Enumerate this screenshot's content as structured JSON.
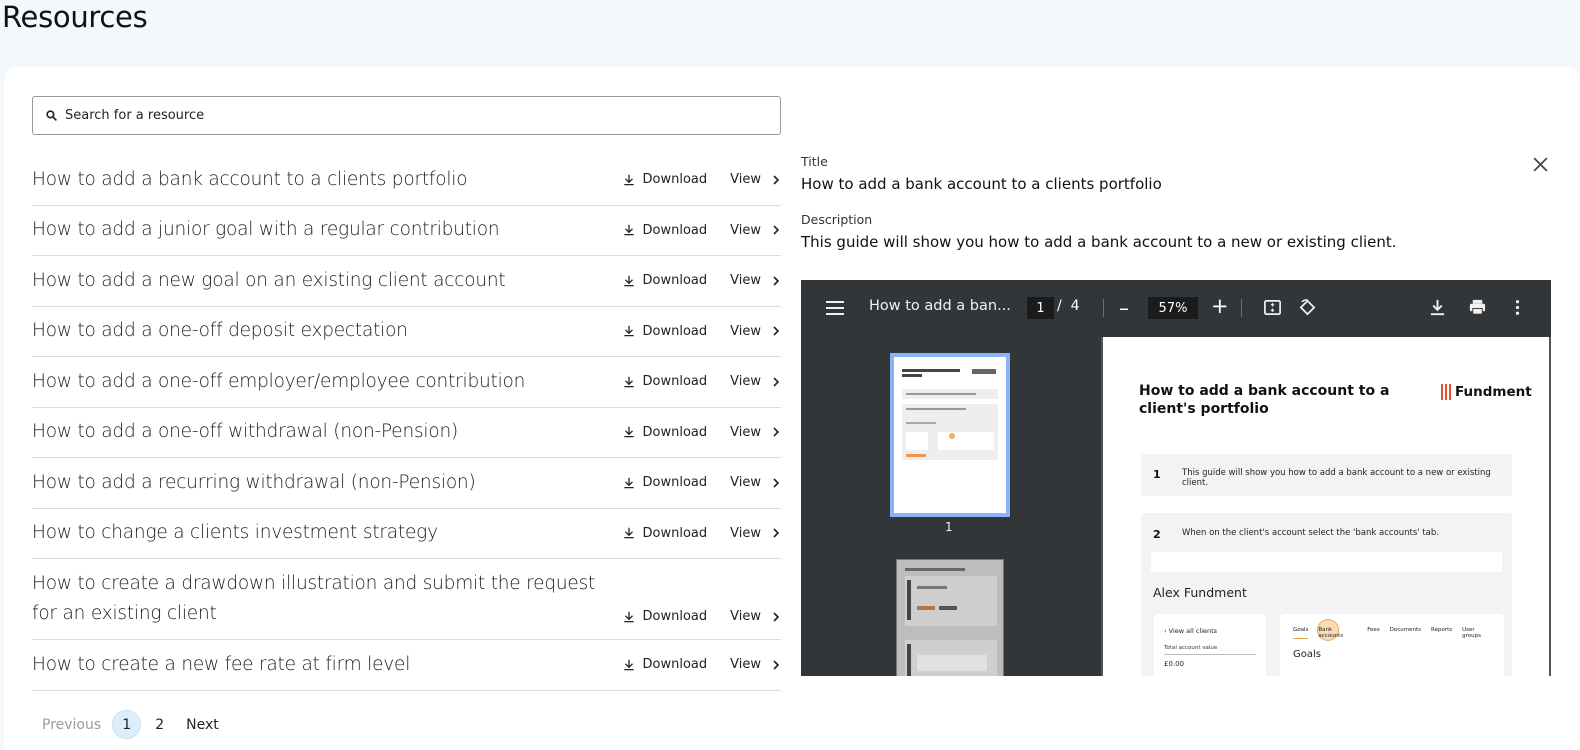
{
  "page": {
    "title": "Resources"
  },
  "search": {
    "placeholder": "Search for a resource",
    "icon": "search-icon"
  },
  "resources": [
    {
      "title": "How to add a bank account to a clients portfolio",
      "download": "Download",
      "view": "View"
    },
    {
      "title": "How to add a junior goal with a regular contribution",
      "download": "Download",
      "view": "View"
    },
    {
      "title": "How to add a new goal on an existing client account",
      "download": "Download",
      "view": "View"
    },
    {
      "title": "How to add a one-off deposit expectation",
      "download": "Download",
      "view": "View"
    },
    {
      "title": "How to add a one-off employer/employee contribution",
      "download": "Download",
      "view": "View"
    },
    {
      "title": "How to add a one-off withdrawal (non-Pension)",
      "download": "Download",
      "view": "View"
    },
    {
      "title": "How to add a recurring withdrawal (non-Pension)",
      "download": "Download",
      "view": "View"
    },
    {
      "title": "How to change a clients investment strategy",
      "download": "Download",
      "view": "View"
    },
    {
      "title": "How to create a drawdown illustration and submit the request for an existing client",
      "download": "Download",
      "view": "View"
    },
    {
      "title": "How to create a new fee rate at firm level",
      "download": "Download",
      "view": "View"
    }
  ],
  "pagination": {
    "previous": "Previous",
    "pages": [
      "1",
      "2"
    ],
    "current": "1",
    "next": "Next"
  },
  "detail": {
    "title_label": "Title",
    "title_value": "How to add a bank account to a clients portfolio",
    "description_label": "Description",
    "description_value": "This guide will show you how to add a bank account to a new or existing client."
  },
  "viewer": {
    "doc_name": "How to add a ban...",
    "page_current": "1",
    "page_sep": "/",
    "page_total": "4",
    "zoom_minus": "–",
    "zoom": "57%",
    "zoom_plus": "+",
    "thumb_label": "1",
    "pdf": {
      "heading": "How to add a bank account to a client's portfolio",
      "logo": "Fundment",
      "step1_num": "1",
      "step1_text": "This guide will show you how to add a bank account to a new or existing client.",
      "step2_num": "2",
      "step2_text": "When on the client's account select the 'bank accounts' tab.",
      "client_name": "Alex Fundment",
      "view_all": "‹  View all clients",
      "total_label": "Total account value",
      "total_value": "£0.00",
      "tabs": [
        "Goals",
        "Bank accounts",
        "Fees",
        "Documents",
        "Reports",
        "User groups"
      ],
      "section": "Goals"
    }
  }
}
